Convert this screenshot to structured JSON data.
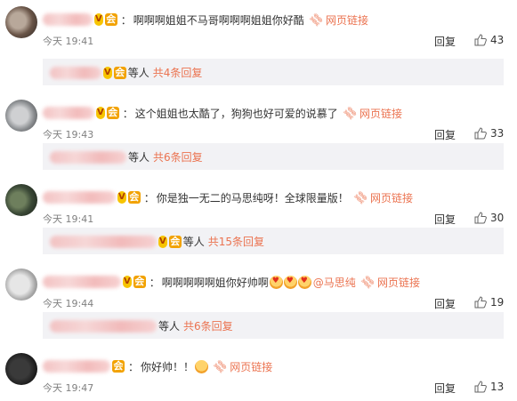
{
  "comments": [
    {
      "text": "啊啊啊姐姐不马哥啊啊啊姐姐你好酷",
      "link_label": "网页链接",
      "time": "今天 19:41",
      "reply": "回复",
      "likes": "43",
      "sub": {
        "text": "等人",
        "count": "共4条回复"
      }
    },
    {
      "text": "这个姐姐也太酷了，狗狗也好可爱的说慕了",
      "link_label": "网页链接",
      "time": "今天 19:43",
      "reply": "回复",
      "likes": "33",
      "sub": {
        "text": "等人",
        "count": "共6条回复"
      }
    },
    {
      "text": "你是独一无二的马思纯呀！全球限量版！",
      "link_label": "网页链接",
      "time": "今天 19:41",
      "reply": "回复",
      "likes": "30",
      "sub": {
        "text": "等人",
        "count": "共15条回复"
      }
    },
    {
      "text": "啊啊啊啊啊姐你好帅啊",
      "mention": "@马思纯",
      "link_label": "网页链接",
      "time": "今天 19:44",
      "reply": "回复",
      "likes": "19",
      "sub": {
        "text": "等人",
        "count": "共6条回复"
      }
    },
    {
      "text": "你好帅！！",
      "link_label": "网页链接",
      "time": "今天 19:47",
      "reply": "回复",
      "likes": "13"
    }
  ]
}
